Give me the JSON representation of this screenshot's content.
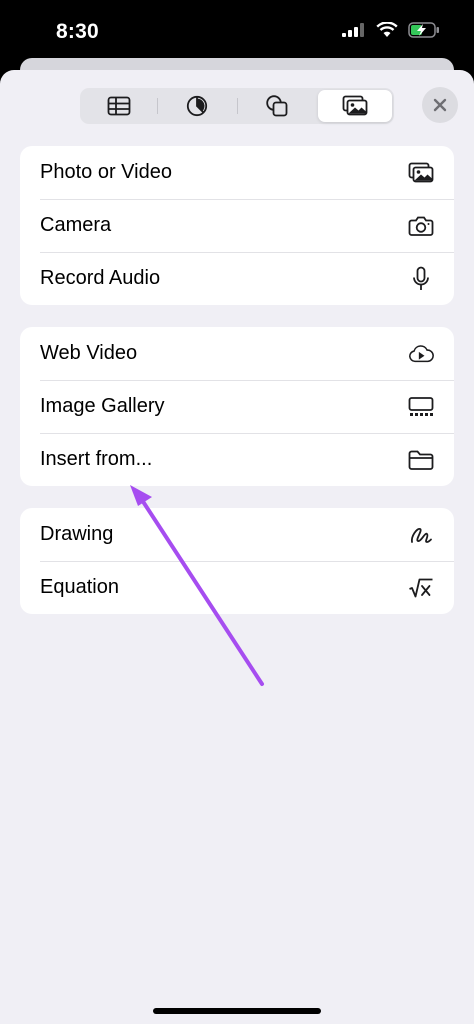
{
  "status_bar": {
    "time": "8:30"
  },
  "toolbar": {
    "tabs": [
      {
        "name": "table"
      },
      {
        "name": "chart"
      },
      {
        "name": "shapes"
      },
      {
        "name": "media",
        "selected": true
      }
    ]
  },
  "groups": [
    {
      "items": [
        {
          "label": "Photo or Video",
          "icon": "photo-library-icon"
        },
        {
          "label": "Camera",
          "icon": "camera-icon"
        },
        {
          "label": "Record Audio",
          "icon": "microphone-icon"
        }
      ]
    },
    {
      "items": [
        {
          "label": "Web Video",
          "icon": "cloud-play-icon"
        },
        {
          "label": "Image Gallery",
          "icon": "image-gallery-icon"
        },
        {
          "label": "Insert from...",
          "icon": "folder-icon"
        }
      ]
    },
    {
      "items": [
        {
          "label": "Drawing",
          "icon": "drawing-icon"
        },
        {
          "label": "Equation",
          "icon": "equation-icon"
        }
      ]
    }
  ],
  "annotation": {
    "color": "#a64df0"
  }
}
